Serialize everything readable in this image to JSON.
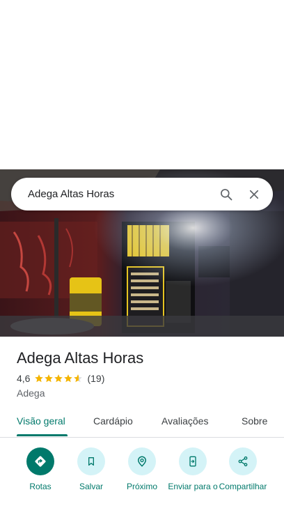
{
  "search": {
    "query": "Adega Altas Horas"
  },
  "icons": {
    "search": "search-icon",
    "close": "close-icon",
    "directions": "directions-icon",
    "save": "bookmark-icon",
    "nearby": "nearby-icon",
    "send": "send-to-phone-icon",
    "share": "share-icon",
    "star": "star-icon"
  },
  "place": {
    "name": "Adega Altas Horas",
    "rating": "4,6",
    "rating_value": 4.6,
    "max_rating": 5,
    "review_count": "(19)",
    "category": "Adega"
  },
  "tabs": [
    {
      "label": "Visão geral",
      "active": true
    },
    {
      "label": "Cardápio",
      "active": false
    },
    {
      "label": "Avaliações",
      "active": false
    },
    {
      "label": "Sobre",
      "active": false
    }
  ],
  "actions": [
    {
      "label": "Rotas",
      "icon": "directions-icon"
    },
    {
      "label": "Salvar",
      "icon": "bookmark-icon"
    },
    {
      "label": "Próximo",
      "icon": "nearby-icon"
    },
    {
      "label": "Enviar para o",
      "icon": "send-to-phone-icon"
    },
    {
      "label": "Compartilhar",
      "icon": "share-icon"
    }
  ],
  "colors": {
    "accent": "#00796b",
    "action_bg": "#d4f3f7",
    "star": "#f4b400"
  }
}
